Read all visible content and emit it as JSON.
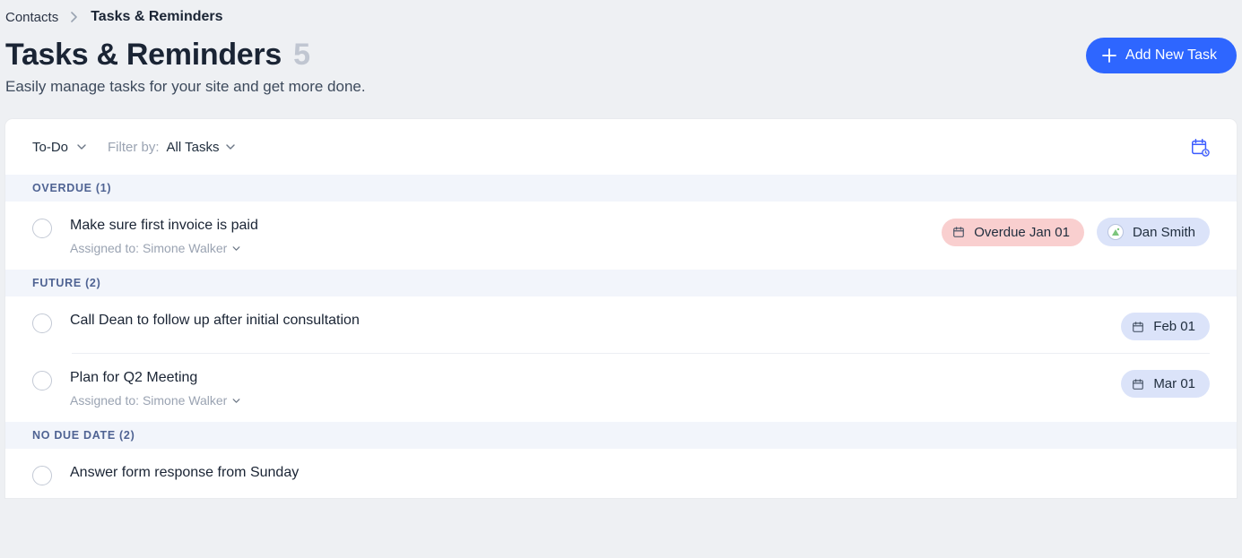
{
  "breadcrumb": {
    "parent": "Contacts",
    "current": "Tasks & Reminders"
  },
  "header": {
    "title": "Tasks & Reminders",
    "count": "5",
    "subtitle": "Easily manage tasks for your site and get more done.",
    "add_button": "Add New Task"
  },
  "toolbar": {
    "view_dropdown": "To-Do",
    "filter_label": "Filter by:",
    "filter_value": "All Tasks"
  },
  "sections": {
    "overdue": {
      "label": "OVERDUE (1)"
    },
    "future": {
      "label": "FUTURE (2)"
    },
    "no_due": {
      "label": "NO DUE DATE (2)"
    }
  },
  "tasks": {
    "overdue": [
      {
        "title": "Make sure first invoice is paid",
        "assigned": "Assigned to: Simone Walker",
        "due_pill": "Overdue Jan 01",
        "contact": "Dan Smith"
      }
    ],
    "future": [
      {
        "title": "Call Dean to follow up after initial consultation",
        "due_pill": "Feb 01"
      },
      {
        "title": "Plan for Q2 Meeting",
        "assigned": "Assigned to: Simone Walker",
        "due_pill": "Mar 01"
      }
    ],
    "no_due": [
      {
        "title": "Answer form response from Sunday"
      }
    ]
  },
  "colors": {
    "primary": "#2e66ff",
    "overdue_pill": "#f9cfcf",
    "default_pill": "#dbe3f9",
    "section_bg": "#f2f5fb"
  }
}
